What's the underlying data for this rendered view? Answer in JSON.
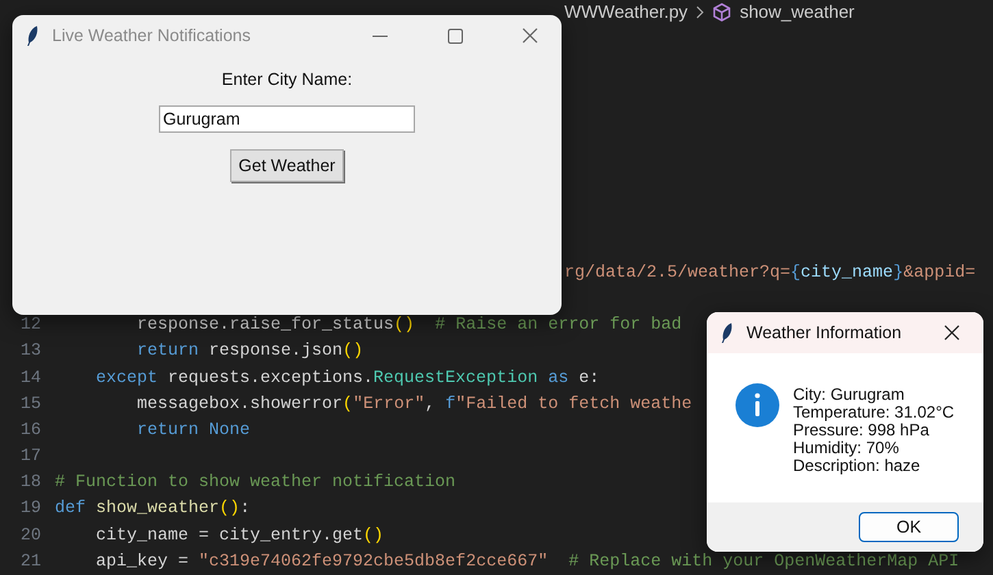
{
  "editor": {
    "breadcrumb": [
      {
        "text": "WWWeather.py",
        "kind": "file"
      },
      {
        "text": "show_weather",
        "kind": "symbol"
      }
    ],
    "fragment_line": {
      "tokens": [
        {
          "text": "rg/data/2.5/weather?q=",
          "kind": "str"
        },
        {
          "text": "{",
          "kind": "brace"
        },
        {
          "text": "city_name",
          "kind": "var"
        },
        {
          "text": "}",
          "kind": "brace"
        },
        {
          "text": "&appid=",
          "kind": "str"
        }
      ]
    },
    "code_lines": [
      {
        "number": "12",
        "tokens": [
          {
            "text": "        response.raise_for_status",
            "kind": "plain"
          },
          {
            "text": "()",
            "kind": "paren"
          },
          {
            "text": "  # Raise an error for bad",
            "kind": "cm"
          }
        ]
      },
      {
        "number": "13",
        "tokens": [
          {
            "text": "        return",
            "kind": "kw"
          },
          {
            "text": " response.json",
            "kind": "plain"
          },
          {
            "text": "()",
            "kind": "paren"
          }
        ]
      },
      {
        "number": "14",
        "tokens": [
          {
            "text": "    except",
            "kind": "kw"
          },
          {
            "text": " requests.exceptions.",
            "kind": "plain"
          },
          {
            "text": "RequestException",
            "kind": "cls"
          },
          {
            "text": " as",
            "kind": "kw"
          },
          {
            "text": " e:",
            "kind": "plain"
          }
        ]
      },
      {
        "number": "15",
        "tokens": [
          {
            "text": "        messagebox.showerror",
            "kind": "plain"
          },
          {
            "text": "(",
            "kind": "paren"
          },
          {
            "text": "\"Error\"",
            "kind": "str"
          },
          {
            "text": ", ",
            "kind": "plain"
          },
          {
            "text": "f",
            "kind": "kw"
          },
          {
            "text": "\"Failed to fetch weathe",
            "kind": "str"
          }
        ]
      },
      {
        "number": "16",
        "tokens": [
          {
            "text": "        return None",
            "kind": "kw"
          }
        ]
      },
      {
        "number": "17"
      },
      {
        "number": "18",
        "tokens": [
          {
            "text": "# Function to show weather notification",
            "kind": "cm"
          }
        ]
      },
      {
        "number": "19",
        "tokens": [
          {
            "text": "def",
            "kind": "kw"
          },
          {
            "text": " show_weather",
            "kind": "fn"
          },
          {
            "text": "()",
            "kind": "paren"
          },
          {
            "text": ":",
            "kind": "plain"
          }
        ]
      },
      {
        "number": "20",
        "tokens": [
          {
            "text": "    city_name = city_entry.get",
            "kind": "plain"
          },
          {
            "text": "()",
            "kind": "paren"
          }
        ]
      },
      {
        "number": "21",
        "tokens": [
          {
            "text": "    api_key = ",
            "kind": "plain"
          },
          {
            "text": "\"c319e74062fe9792cbe5db8ef2cce667\"",
            "kind": "str"
          },
          {
            "text": "  # Replace with your OpenWeatherMap API",
            "kind": "cm"
          }
        ]
      }
    ]
  },
  "main_window": {
    "title": "Live Weather Notifications",
    "active": false,
    "label": "Enter City Name:",
    "city_field": {
      "value": "Gurugram"
    },
    "button": "Get Weather"
  },
  "dialog": {
    "title": "Weather Information",
    "active": true,
    "lines": [
      "City: Gurugram",
      "Temperature: 31.02°C",
      "Pressure: 998 hPa",
      "Humidity: 70%",
      "Description: haze"
    ],
    "button": "OK"
  }
}
